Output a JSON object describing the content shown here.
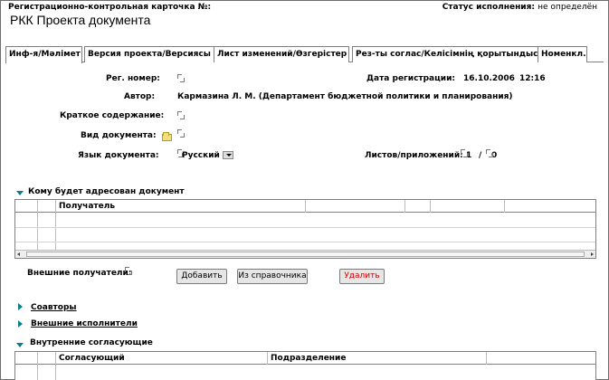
{
  "header": {
    "card_label": "Регистрационно-контрольная карточка №:",
    "status_label": "Статус исполнения:",
    "status_value": "не определён",
    "title": "РКК Проекта документа"
  },
  "tabs": [
    {
      "label": "Инф-я/Мәлімет",
      "active": true
    },
    {
      "label": "Версия проекта/Версиясы",
      "active": false
    },
    {
      "label": "Лист изменений/Өзгерістер",
      "active": false
    },
    {
      "label": "Рез-ты соглас/Келісімнің қорытындысы",
      "active": false
    },
    {
      "label": "Номенкл.",
      "active": false
    }
  ],
  "form": {
    "reg_number_label": "Рег. номер:",
    "reg_date_label": "Дата регистрации:",
    "reg_date_value": "16.10.2006",
    "reg_time_value": "12:16",
    "author_label": "Автор:",
    "author_value": "Кармазина Л. М. (Департамент бюджетной политики и планирования)",
    "summary_label": "Краткое содержание:",
    "doctype_label": "Вид документа:",
    "language_label": "Язык документа:",
    "language_value": "Русский",
    "sheets_label": "Листов/приложений:",
    "sheets_value": "1",
    "attachments_value": "0"
  },
  "addressed": {
    "title": "Кому будет адресован документ",
    "columns": [
      "",
      "Получатель",
      "",
      "",
      ""
    ]
  },
  "external": {
    "label": "Внешние получатели:",
    "add_button": "Добавить",
    "from_ref_button": "Из справочника",
    "delete_button": "Удалить"
  },
  "sections": {
    "coauthors": "Соавторы",
    "ext_executors": "Внешние исполнители",
    "internal_approvers": "Внутренние согласующие"
  },
  "approvers_table": {
    "columns": [
      "Согласующий",
      "Подразделение"
    ]
  },
  "colors": {
    "accent_triangle": "#0a7d8c",
    "delete_text": "#d40000"
  }
}
